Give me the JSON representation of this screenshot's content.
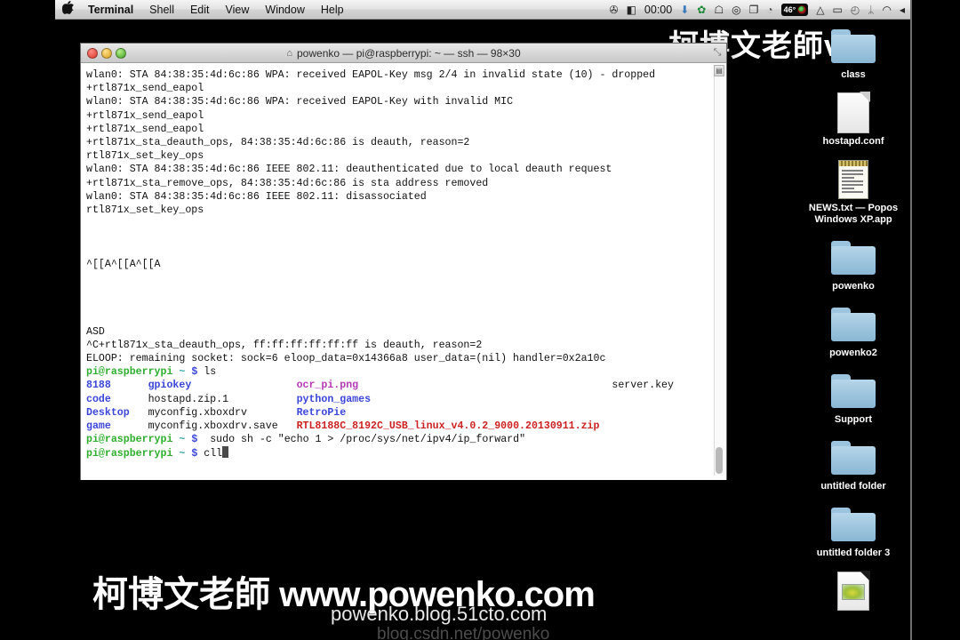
{
  "menubar": {
    "apple_glyph": "●",
    "items": [
      {
        "label": "Terminal",
        "bold": true
      },
      {
        "label": "Shell",
        "bold": false
      },
      {
        "label": "Edit",
        "bold": false
      },
      {
        "label": "View",
        "bold": false
      },
      {
        "label": "Window",
        "bold": false
      },
      {
        "label": "Help",
        "bold": false
      }
    ],
    "clock": "00:00",
    "temperature": "46°",
    "status_icons": [
      {
        "name": "wings-icon",
        "glyph": "✇"
      },
      {
        "name": "box-icon",
        "glyph": "◧"
      },
      {
        "name": "download-icon",
        "glyph": "⬇"
      },
      {
        "name": "dropbox-sync-icon",
        "glyph": "✿"
      },
      {
        "name": "bell-icon",
        "glyph": "☖"
      },
      {
        "name": "creative-cloud-icon",
        "glyph": "◎"
      },
      {
        "name": "screens-icon",
        "glyph": "❐"
      },
      {
        "name": "spotlight-dim-icon",
        "glyph": "◔"
      },
      {
        "name": "google-drive-icon",
        "glyph": "△"
      },
      {
        "name": "airplay-icon",
        "glyph": "▭"
      },
      {
        "name": "timemachine-icon",
        "glyph": "◴"
      },
      {
        "name": "bluetooth-icon",
        "glyph": "ᛦ"
      },
      {
        "name": "wifi-icon",
        "glyph": "◠"
      },
      {
        "name": "volume-icon",
        "glyph": "◂"
      }
    ]
  },
  "terminal": {
    "title": "powenko — pi@raspberrypi: ~ — ssh — 98×30",
    "title_glyph": "⌂",
    "resize_glyph": "⤡",
    "scroll_up_glyph": "▤",
    "lines": [
      {
        "type": "plain",
        "text": "wlan0: STA 84:38:35:4d:6c:86 WPA: received EAPOL-Key msg 2/4 in invalid state (10) - dropped"
      },
      {
        "type": "plain",
        "text": "+rtl871x_send_eapol"
      },
      {
        "type": "plain",
        "text": "wlan0: STA 84:38:35:4d:6c:86 WPA: received EAPOL-Key with invalid MIC"
      },
      {
        "type": "plain",
        "text": "+rtl871x_send_eapol"
      },
      {
        "type": "plain",
        "text": "+rtl871x_send_eapol"
      },
      {
        "type": "plain",
        "text": "+rtl871x_sta_deauth_ops, 84:38:35:4d:6c:86 is deauth, reason=2"
      },
      {
        "type": "plain",
        "text": "rtl871x_set_key_ops"
      },
      {
        "type": "plain",
        "text": "wlan0: STA 84:38:35:4d:6c:86 IEEE 802.11: deauthenticated due to local deauth request"
      },
      {
        "type": "plain",
        "text": "+rtl871x_sta_remove_ops, 84:38:35:4d:6c:86 is sta address removed"
      },
      {
        "type": "plain",
        "text": "wlan0: STA 84:38:35:4d:6c:86 IEEE 802.11: disassociated"
      },
      {
        "type": "plain",
        "text": "rtl871x_set_key_ops"
      },
      {
        "type": "blank",
        "text": ""
      },
      {
        "type": "blank",
        "text": ""
      },
      {
        "type": "blank",
        "text": ""
      },
      {
        "type": "plain",
        "text": "^[[A^[[A^[[A"
      },
      {
        "type": "blank",
        "text": ""
      },
      {
        "type": "blank",
        "text": ""
      },
      {
        "type": "blank",
        "text": ""
      },
      {
        "type": "blank",
        "text": ""
      },
      {
        "type": "plain",
        "text": "ASD"
      },
      {
        "type": "plain",
        "text": "^C+rtl871x_sta_deauth_ops, ff:ff:ff:ff:ff:ff is deauth, reason=2"
      },
      {
        "type": "plain",
        "text": "ELOOP: remaining socket: sock=6 eloop_data=0x14366a8 user_data=(nil) handler=0x2a10c"
      }
    ],
    "prompt": {
      "user_host": "pi@raspberrypi",
      "path": "~",
      "sigil": "$"
    },
    "command_ls": "ls",
    "ls_listing": [
      {
        "col1": {
          "text": "8188",
          "color": "dir"
        },
        "col2": {
          "text": "gpiokey",
          "color": "dir"
        },
        "col3": {
          "text": "ocr_pi.png",
          "color": "magenta"
        },
        "col4": {
          "text": "server.key",
          "color": "plain"
        }
      },
      {
        "col1": {
          "text": "code",
          "color": "dir"
        },
        "col2": {
          "text": "hostapd.zip.1",
          "color": "plain"
        },
        "col3": {
          "text": "python_games",
          "color": "dir"
        },
        "col4": {
          "text": "",
          "color": "plain"
        }
      },
      {
        "col1": {
          "text": "Desktop",
          "color": "dir"
        },
        "col2": {
          "text": "myconfig.xboxdrv",
          "color": "plain"
        },
        "col3": {
          "text": "RetroPie",
          "color": "dir"
        },
        "col4": {
          "text": "",
          "color": "plain"
        }
      },
      {
        "col1": {
          "text": "game",
          "color": "dir"
        },
        "col2": {
          "text": "myconfig.xboxdrv.save",
          "color": "plain"
        },
        "col3": {
          "text": "RTL8188C_8192C_USB_linux_v4.0.2_9000.20130911.zip",
          "color": "red"
        },
        "col4": {
          "text": "",
          "color": "plain"
        }
      }
    ],
    "command_sudo": " sudo sh -c \"echo 1 > /proc/sys/net/ipv4/ip_forward\"",
    "command_current": "cll"
  },
  "desktop": {
    "icons": [
      {
        "label": "class",
        "type": "folder"
      },
      {
        "label": "hostapd.conf",
        "type": "doc"
      },
      {
        "label": "NEWS.txt — Popos Windows XP.app",
        "type": "textdoc"
      },
      {
        "label": "powenko",
        "type": "folder"
      },
      {
        "label": "powenko2",
        "type": "folder"
      },
      {
        "label": "Support",
        "type": "folder"
      },
      {
        "label": "untitled folder",
        "type": "folder"
      },
      {
        "label": "untitled folder 3",
        "type": "folder"
      },
      {
        "label": "",
        "type": "imagedoc"
      }
    ]
  },
  "watermarks": {
    "top": "柯博文老師",
    "top_partial": "vw",
    "main_cjk": "柯博文老師",
    "main_latin": " www.powenko.com",
    "sub": "powenko.blog.51cto.com",
    "sub2": "blog.csdn.net/powenko"
  }
}
